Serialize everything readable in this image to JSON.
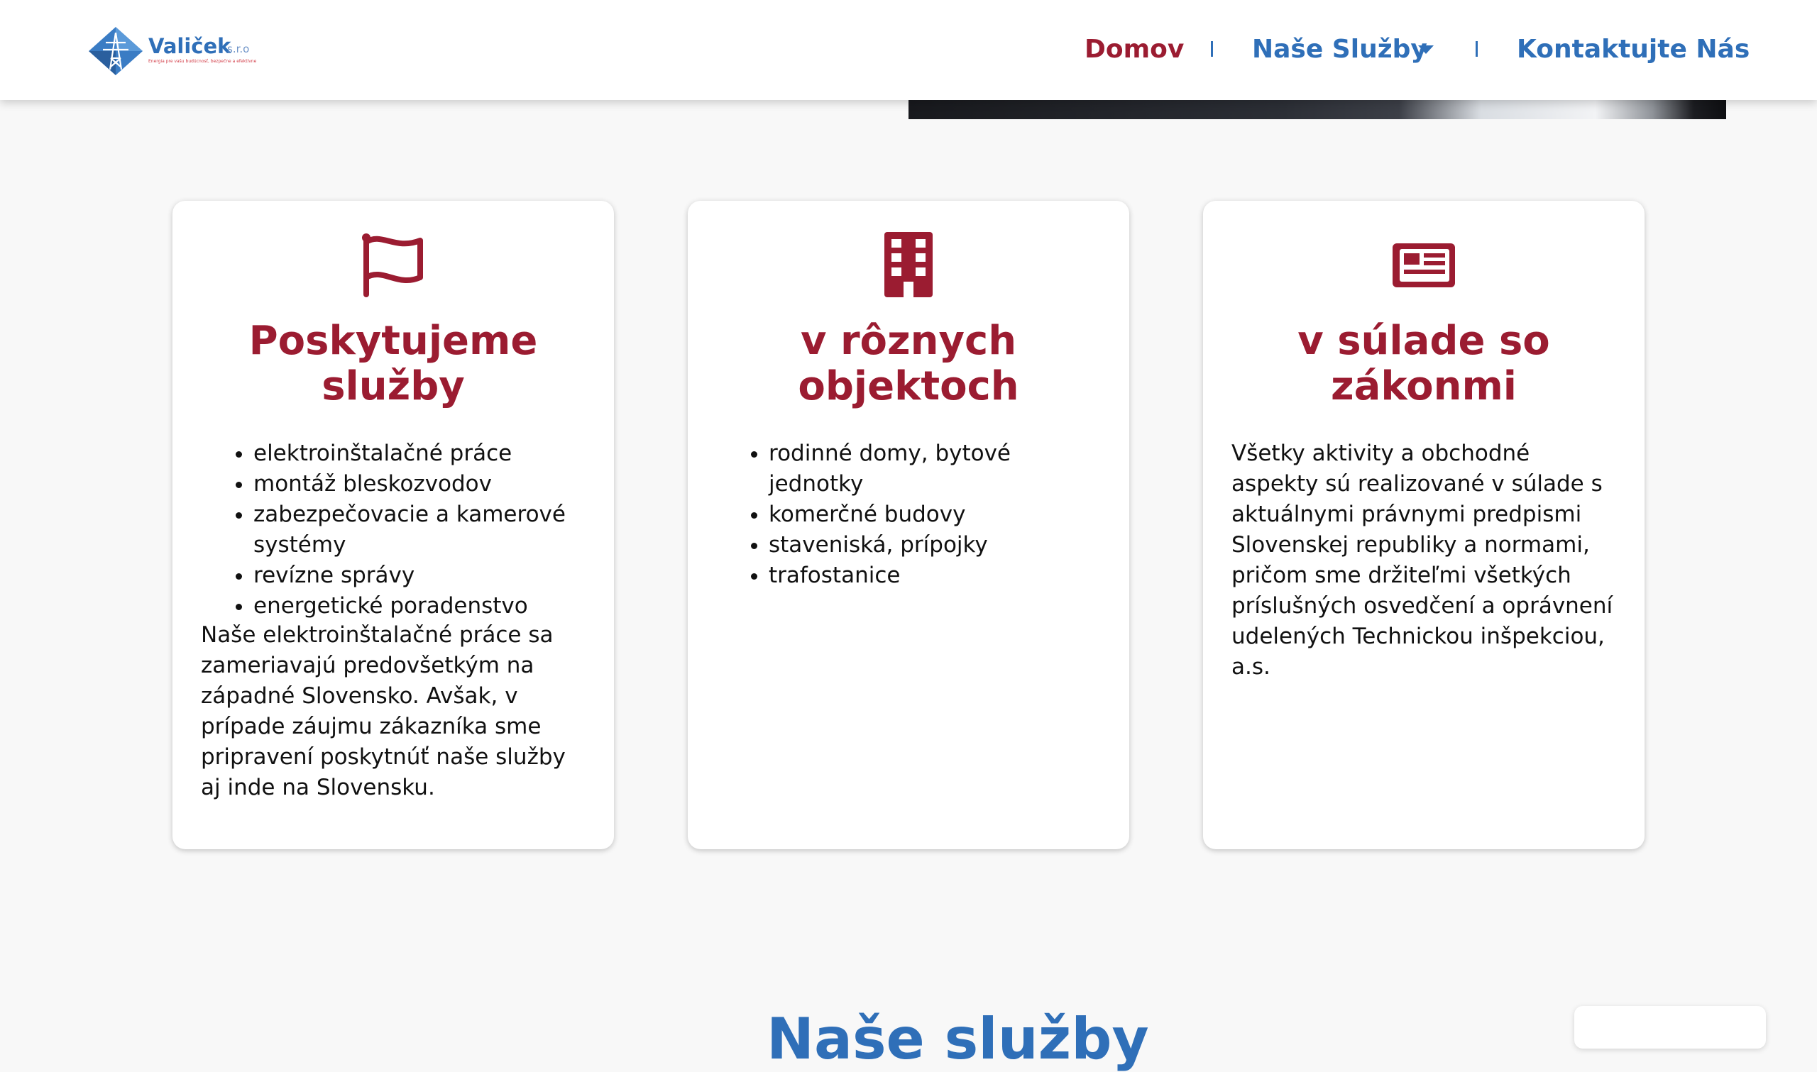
{
  "header": {
    "logo": {
      "name": "Valiček",
      "suffix": "s.r.o",
      "tagline": "Energia pre vašu budúcnosť, bezpečne a efektívne"
    },
    "nav": {
      "home": "Domov",
      "services": "Naše Služby",
      "contact": "Kontaktujte Nás"
    }
  },
  "colors": {
    "accent_red": "#9b1c31",
    "brand_blue": "#2f6fb8",
    "page_bg": "#f8f8f8"
  },
  "cards": [
    {
      "icon": "flag-icon",
      "title": "Poskytujeme služby",
      "items": [
        "elektroinštalačné práce",
        "montáž bleskozvodov",
        "zabezpečovacie a kamerové systémy",
        "revízne správy",
        "energetické poradenstvo"
      ],
      "text": "Naše elektroinštalačné práce sa zameriavajú predovšetkým na západné Slovensko. Avšak, v prípade záujmu zákazníka sme pripravení poskytnúť naše služby aj inde na Slovensku."
    },
    {
      "icon": "building-icon",
      "title": "v rôznych objektoch",
      "items": [
        "rodinné domy, bytové jednotky",
        "komerčné budovy",
        "staveniská, prípojky",
        "trafostanice"
      ]
    },
    {
      "icon": "newspaper-icon",
      "title": "v súlade so zákonmi",
      "text": "Všetky aktivity a obchodné aspekty sú realizované v súlade s aktuálnymi právnymi predpismi Slovenskej republiky a normami, pričom sme držiteľmi všetkých príslušných osvedčení a oprávnení udelených Technickou inšpekciou, a.s."
    }
  ],
  "next_section": {
    "title": "Naše služby"
  }
}
